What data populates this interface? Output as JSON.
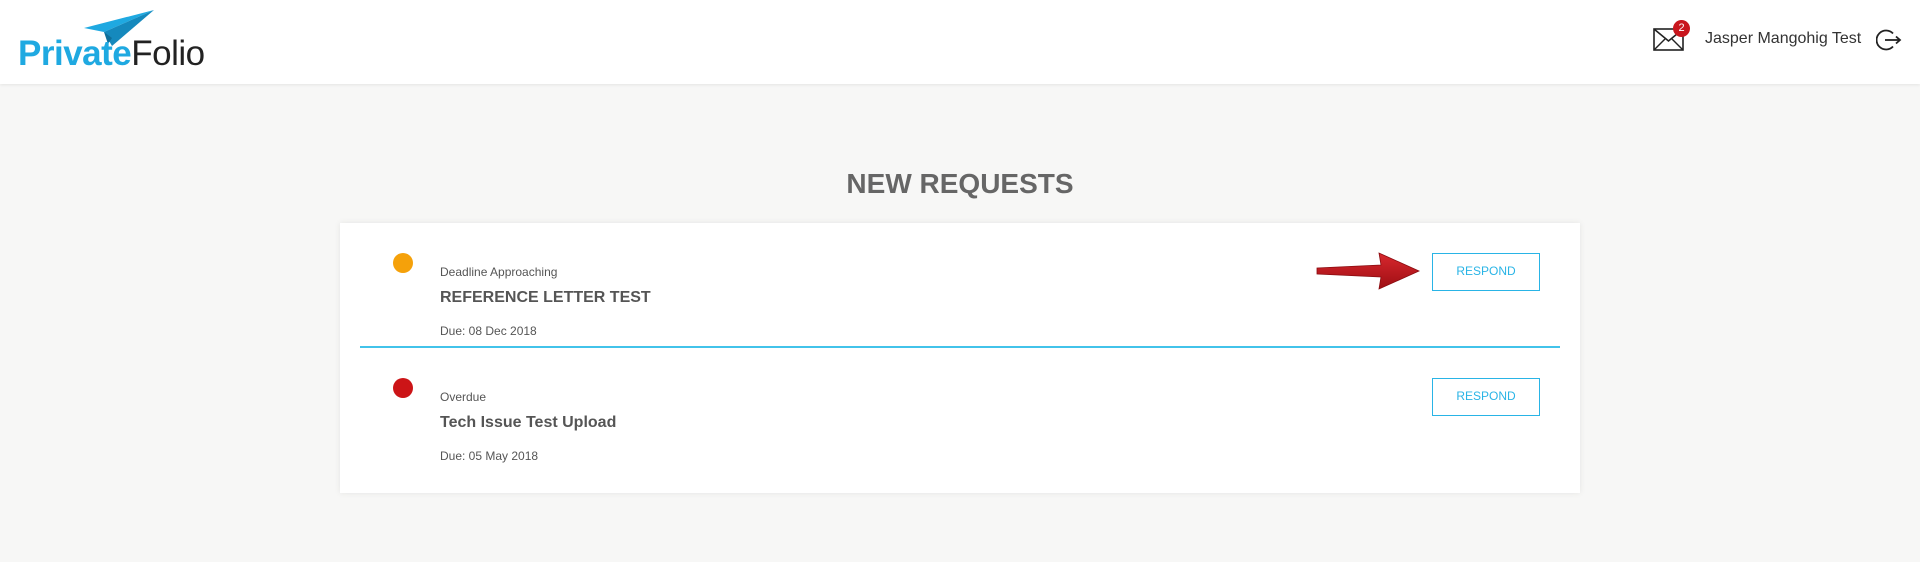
{
  "brand": {
    "part1": "Private",
    "part2": "Folio"
  },
  "header": {
    "mail_badge": "2",
    "username": "Jasper Mangohig Test"
  },
  "page": {
    "title": "NEW REQUESTS"
  },
  "requests": [
    {
      "status": "Deadline Approaching",
      "status_color": "#f5a10a",
      "title": "REFERENCE LETTER TEST",
      "due": "Due: 08 Dec 2018",
      "action": "RESPOND"
    },
    {
      "status": "Overdue",
      "status_color": "#cc1417",
      "title": "Tech Issue Test Upload",
      "due": "Due: 05 May 2018",
      "action": "RESPOND"
    }
  ],
  "colors": {
    "accent": "#29b4e6",
    "divider": "#42c3ea",
    "annotation_arrow": "#c0141b"
  },
  "icons": [
    "paper-plane-icon",
    "envelope-icon",
    "logout-icon",
    "arrow-annotation-icon"
  ]
}
